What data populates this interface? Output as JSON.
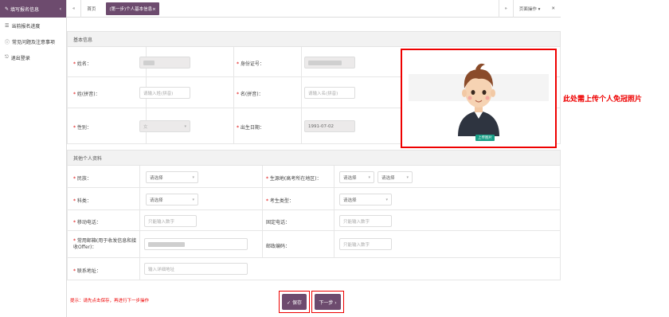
{
  "sidebar": {
    "header_label": "填写报名信息",
    "header_chevron": "‹",
    "items": [
      {
        "icon": "list-icon",
        "glyph": "☰",
        "label": "当前报名进度"
      },
      {
        "icon": "help-icon",
        "glyph": "ⓘ",
        "label": "常见问题及注意事项"
      },
      {
        "icon": "logout-icon",
        "glyph": "⎋",
        "label": "退出登录"
      }
    ]
  },
  "topbar": {
    "back_glyph": "«",
    "home_label": "首页",
    "active_tab": "(第一步)个人基本信息×",
    "forward_glyph": "»",
    "page_ops_label": "页面操作 ▾",
    "close_glyph": "✕"
  },
  "basic_info": {
    "section_title": "基本信息",
    "name_label": "姓名：",
    "id_label": "身份证号：",
    "surname_py_label": "姓(拼音)：",
    "surname_py_placeholder": "请输入姓(拼音)",
    "given_py_label": "名(拼音)：",
    "given_py_placeholder": "请输入名(拼音)",
    "gender_label": "性别：",
    "gender_value": "女",
    "birth_label": "出生日期：",
    "birth_value": "1991-07-02"
  },
  "photo": {
    "upload_label": "上传图片"
  },
  "annotation": "此处需上传个人免冠照片",
  "other_info": {
    "section_title": "其他个人资料",
    "ethnicity_label": "民族：",
    "ethnicity_value": "请选择",
    "origin_label": "生源地(高考所在地区)：",
    "origin_province": "请选择",
    "origin_city": "请选择",
    "subject_label": "科类：",
    "subject_value": "请选择",
    "candidate_type_label": "考生类型：",
    "candidate_type_value": "请选择",
    "mobile_label": "移动电话：",
    "mobile_placeholder": "只能输入数字",
    "landline_label": "固定电话：",
    "landline_placeholder": "只能输入数字",
    "email_label": "常用邮箱(用于收发信息和接收Offer)：",
    "postcode_label": "邮政编码：",
    "postcode_placeholder": "只能输入数字",
    "address_label": "联系地址：",
    "address_placeholder": "输入详细地址"
  },
  "tip": "提示：请先点击保存，再进行下一步操作",
  "actions": {
    "save_label": "✓ 保存",
    "next_label": "下一步 ›"
  },
  "colors": {
    "accent": "#6d4b6e",
    "annotation_red": "#ee0000",
    "upload_green": "#189e86"
  }
}
